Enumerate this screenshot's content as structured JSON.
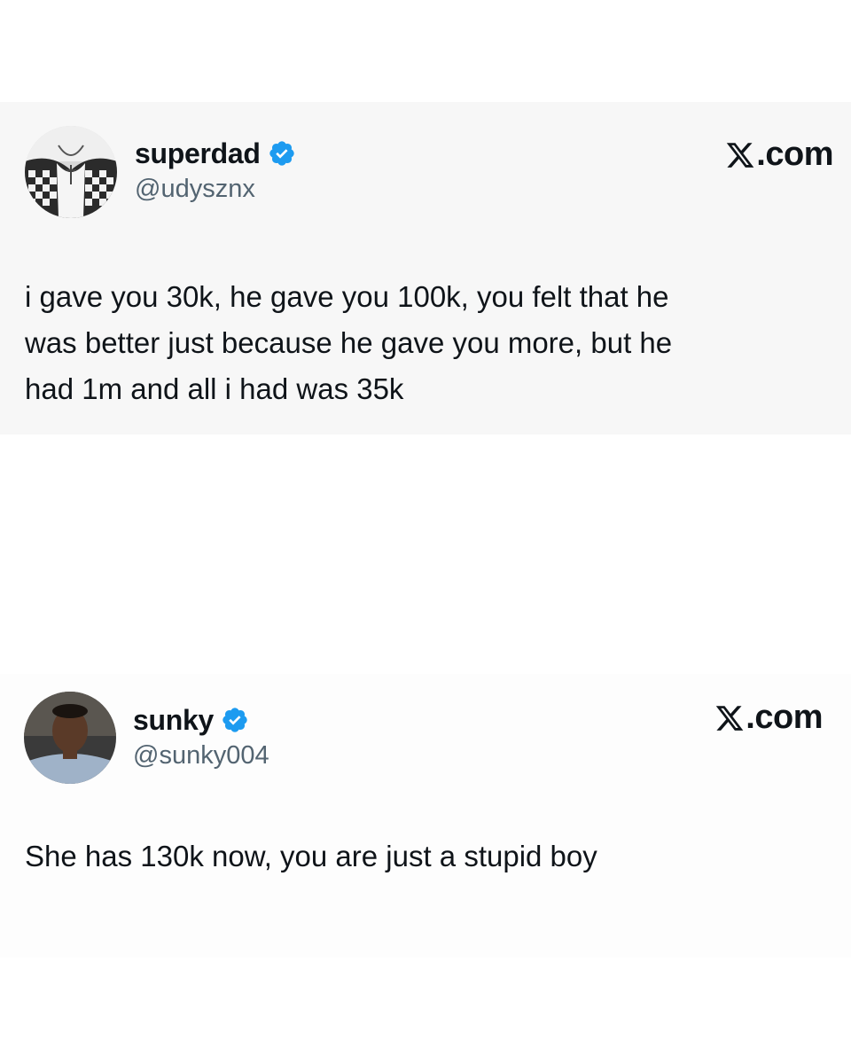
{
  "tweets": [
    {
      "display_name": "superdad",
      "handle": "@udysznx",
      "brand": ".com",
      "verified": true,
      "text": "i gave you 30k, he gave you 100k, you felt that he\nwas better just because he gave you more, but he\nhad 1m and all i had was 35k"
    },
    {
      "display_name": "sunky",
      "handle": "@sunky004",
      "brand": ".com",
      "verified": true,
      "text": "She has 130k now, you are just a stupid boy"
    }
  ],
  "colors": {
    "verified": "#1d9bf0",
    "text": "#0f1419",
    "handle": "#536471"
  }
}
